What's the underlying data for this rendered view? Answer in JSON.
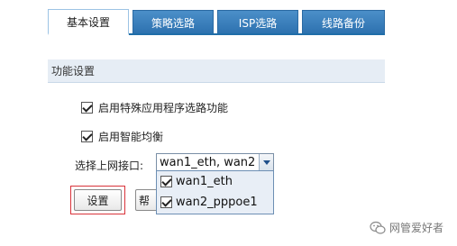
{
  "tabs": [
    {
      "label": "基本设置",
      "active": true
    },
    {
      "label": "策略选路",
      "active": false
    },
    {
      "label": "ISP选路",
      "active": false
    },
    {
      "label": "线路备份",
      "active": false
    }
  ],
  "section": {
    "title": "功能设置"
  },
  "options": {
    "special_app_routing": {
      "label": "启用特殊应用程序选路功能",
      "checked": true
    },
    "smart_balance": {
      "label": "启用智能均衡",
      "checked": true
    }
  },
  "interface_select": {
    "label": "选择上网接口:",
    "value": "wan1_eth, wan2",
    "items": [
      {
        "label": "wan1_eth",
        "checked": true
      },
      {
        "label": "wan2_pppoe1",
        "checked": true
      }
    ]
  },
  "buttons": {
    "set": "设置",
    "help": "帮"
  },
  "watermark": {
    "text": "网管爱好者",
    "icon": "wechat-icon"
  },
  "colors": {
    "tab_active_bg": "#ffffff",
    "tab_bg": "#3d82c0",
    "highlight": "#d9333a"
  }
}
